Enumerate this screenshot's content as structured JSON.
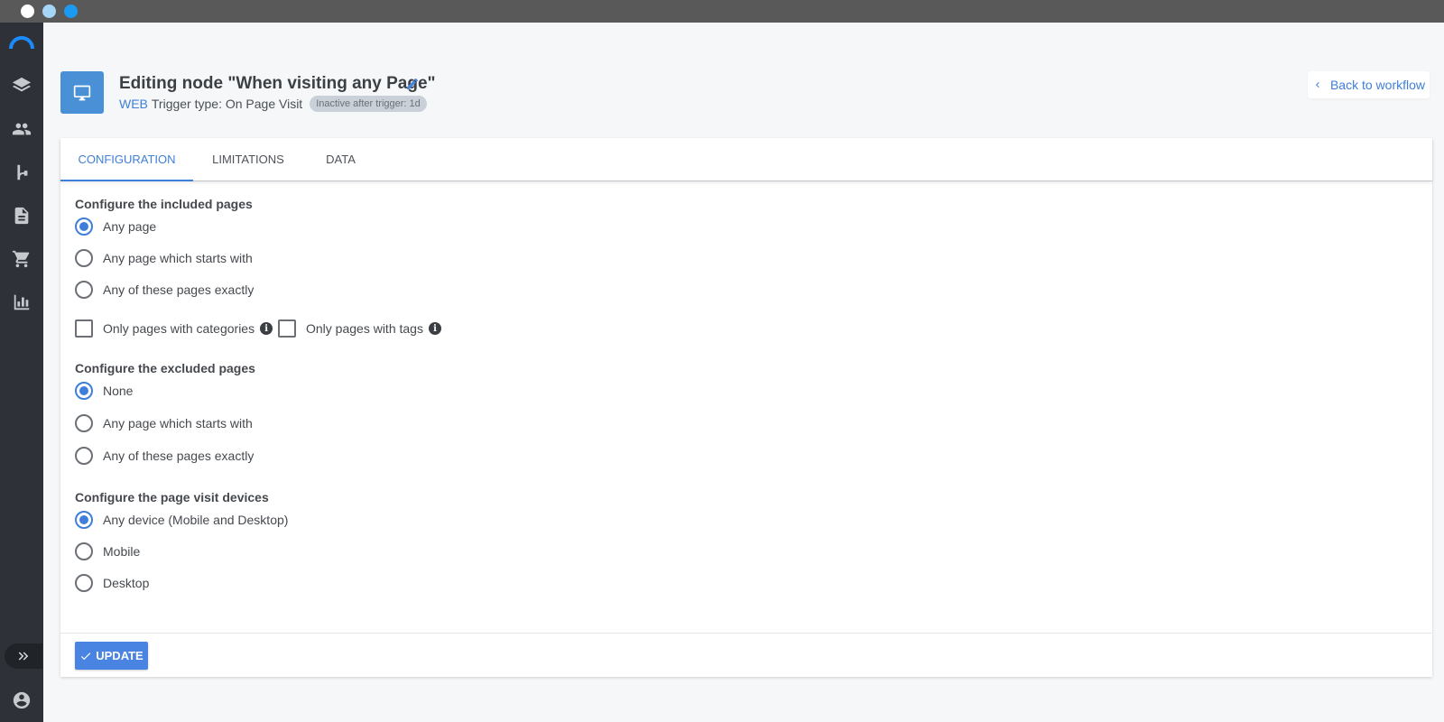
{
  "window": {
    "controls": [
      "close",
      "minimize",
      "maximize"
    ]
  },
  "sidebar": {
    "items": [
      {
        "icon": "layers-icon"
      },
      {
        "icon": "people-icon"
      },
      {
        "icon": "workflow-icon"
      },
      {
        "icon": "document-icon"
      },
      {
        "icon": "cart-icon"
      },
      {
        "icon": "bar-chart-icon"
      }
    ],
    "expand_icon": "double-chevron-right-icon",
    "user_icon": "account-icon"
  },
  "header": {
    "title": "Editing node \"When visiting any Page\"",
    "channel": "WEB",
    "trigger_type": "Trigger type: On Page Visit",
    "badge": "Inactive after trigger: 1d",
    "back_label": "Back to workflow",
    "node_icon": "desktop-icon"
  },
  "tabs": [
    {
      "label": "CONFIGURATION",
      "active": true
    },
    {
      "label": "LIMITATIONS",
      "active": false
    },
    {
      "label": "DATA",
      "active": false
    }
  ],
  "included": {
    "label": "Configure the included pages",
    "options": [
      {
        "label": "Any page",
        "checked": true
      },
      {
        "label": "Any page which starts with",
        "checked": false
      },
      {
        "label": "Any of these pages exactly",
        "checked": false
      }
    ],
    "filters": [
      {
        "label": "Only pages with categories",
        "checked": false
      },
      {
        "label": "Only pages with tags",
        "checked": false
      }
    ]
  },
  "excluded": {
    "label": "Configure the excluded pages",
    "options": [
      {
        "label": "None",
        "checked": true
      },
      {
        "label": "Any page which starts with",
        "checked": false
      },
      {
        "label": "Any of these pages exactly",
        "checked": false
      }
    ]
  },
  "devices": {
    "label": "Configure the page visit devices",
    "options": [
      {
        "label": "Any device (Mobile and Desktop)",
        "checked": true
      },
      {
        "label": "Mobile",
        "checked": false
      },
      {
        "label": "Desktop",
        "checked": false
      }
    ]
  },
  "footer": {
    "update_label": "UPDATE"
  },
  "colors": {
    "accent": "#3f7fd9",
    "sidebar": "#2e3238",
    "titlebar": "#595959"
  }
}
